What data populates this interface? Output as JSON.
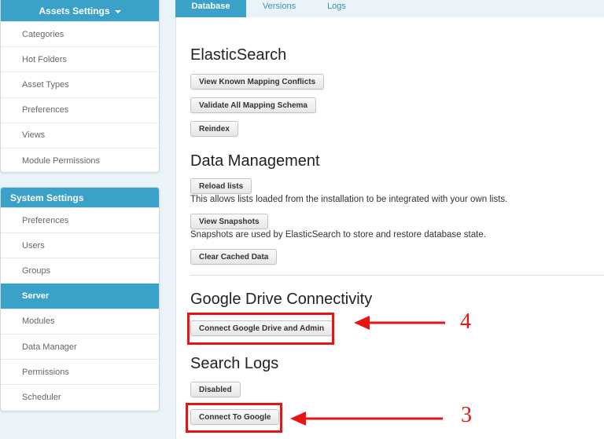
{
  "sidebar": {
    "assets_panel": {
      "title": "Assets Settings",
      "items": [
        "Categories",
        "Hot Folders",
        "Asset Types",
        "Preferences",
        "Views",
        "Module Permissions"
      ]
    },
    "system_panel": {
      "title": "System Settings",
      "items": [
        "Preferences",
        "Users",
        "Groups",
        "Server",
        "Modules",
        "Data Manager",
        "Permissions",
        "Scheduler"
      ],
      "active_item": "Server"
    }
  },
  "tabs": [
    {
      "label": "Database",
      "active": true
    },
    {
      "label": "Versions",
      "active": false
    },
    {
      "label": "Logs",
      "active": false
    }
  ],
  "elasticsearch": {
    "heading": "ElasticSearch",
    "buttons": [
      "View Known Mapping Conflicts",
      "Validate All Mapping Schema",
      "Reindex"
    ]
  },
  "data_management": {
    "heading": "Data Management",
    "reload_button": "Reload lists",
    "reload_note": "This allows lists loaded from the installation to be integrated with your own lists.",
    "snapshots_button": "View Snapshots",
    "snapshots_note": "Snapshots are used by ElasticSearch to store and restore database state.",
    "clear_cache_button": "Clear Cached Data"
  },
  "google_drive": {
    "heading": "Google Drive Connectivity",
    "connect_button": "Connect Google Drive and Admin"
  },
  "search_logs": {
    "heading": "Search Logs",
    "disabled_button": "Disabled",
    "connect_button": "Connect To Google"
  },
  "annotations": {
    "step_drive": "4",
    "step_google": "3",
    "color": "#e81414"
  },
  "colors": {
    "accent": "#3aa1c8",
    "background": "#eaf3f8"
  }
}
